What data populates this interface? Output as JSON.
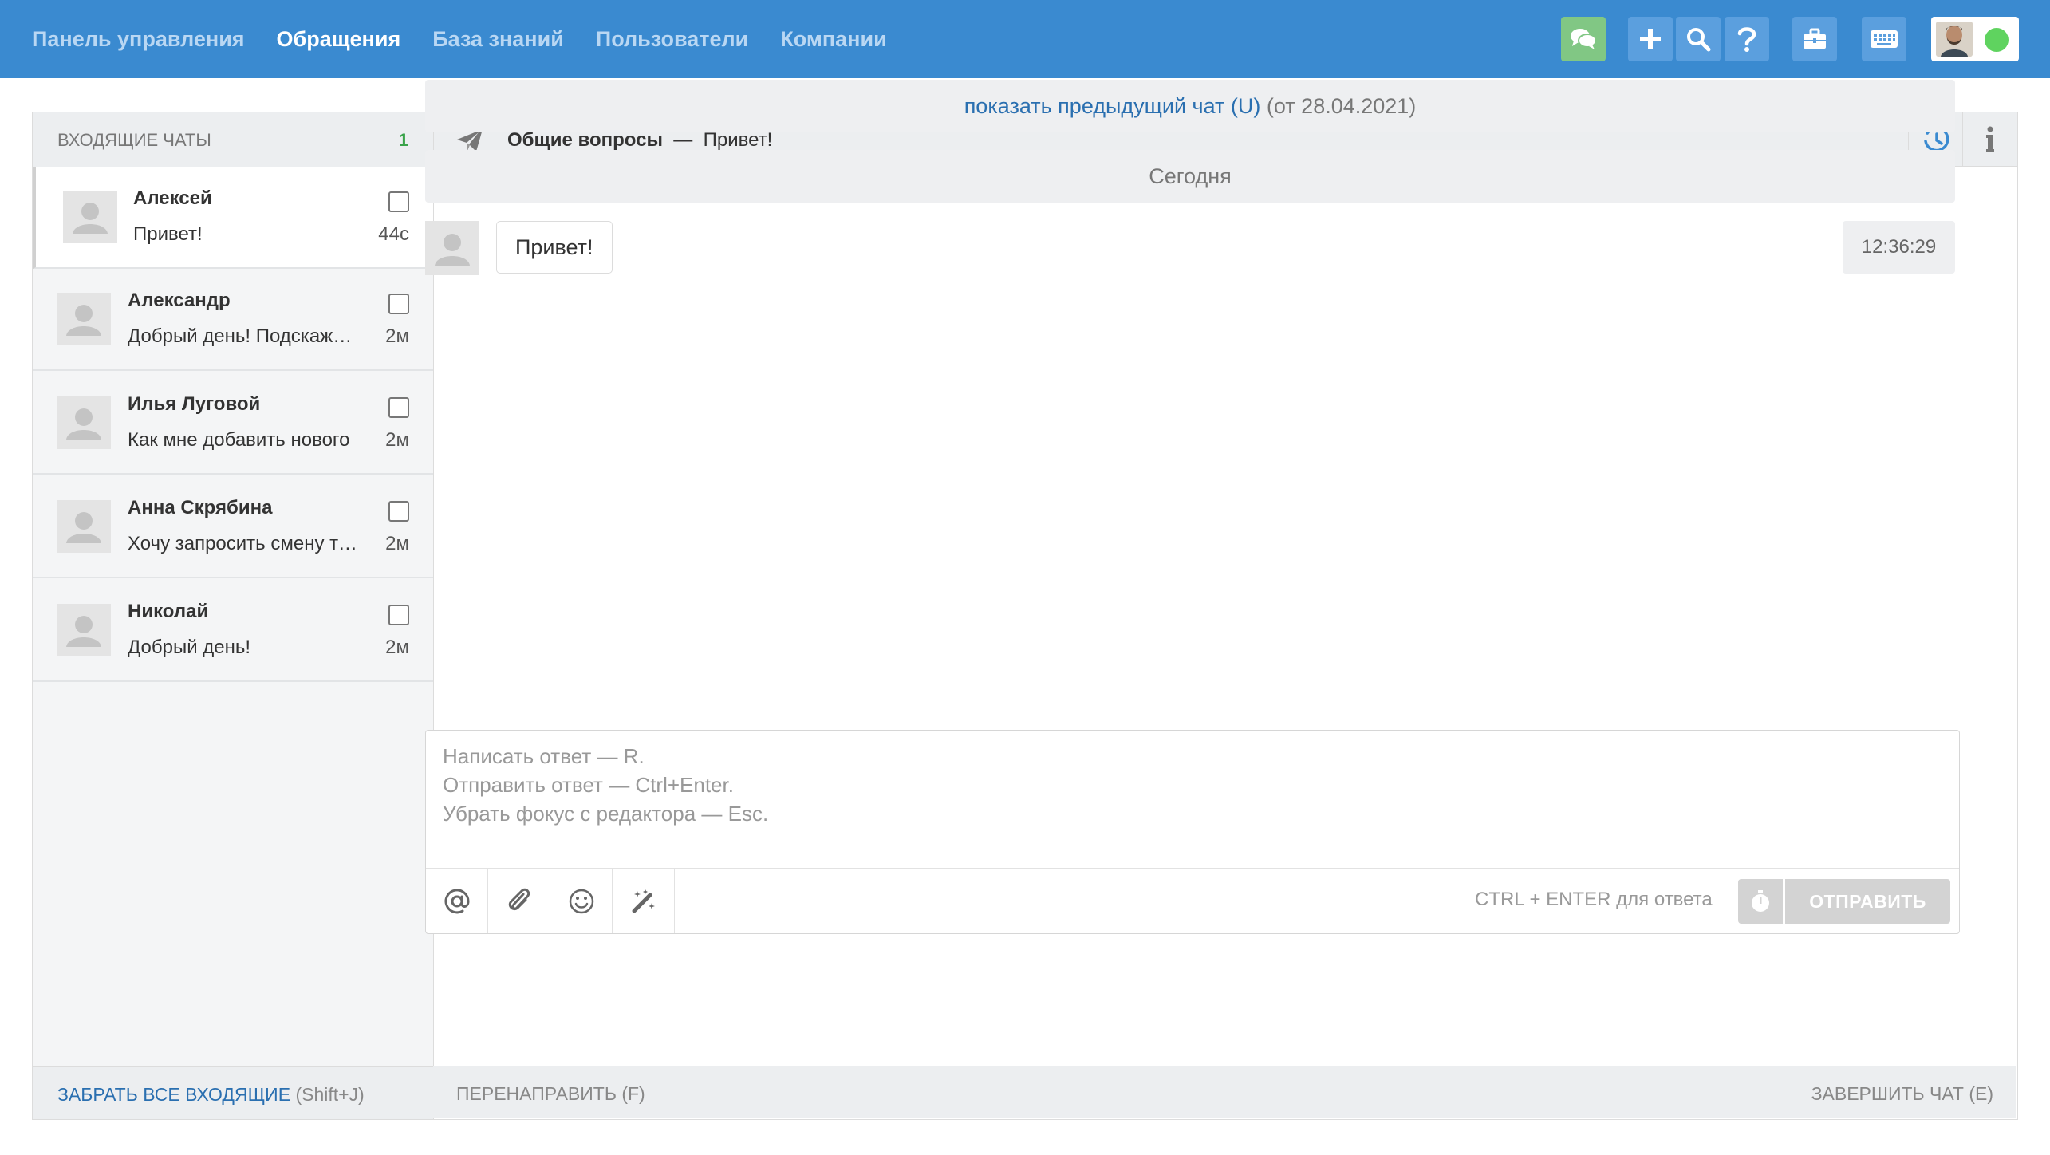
{
  "nav": {
    "items": [
      {
        "label": "Панель управления",
        "active": false
      },
      {
        "label": "Обращения",
        "active": true
      },
      {
        "label": "База знаний",
        "active": false
      },
      {
        "label": "Пользователи",
        "active": false
      },
      {
        "label": "Компании",
        "active": false
      }
    ],
    "right_icons": [
      "chat-bubbles-icon",
      "plus-icon",
      "search-icon",
      "question-icon",
      "briefcase-icon",
      "keyboard-icon"
    ],
    "user_status": "online"
  },
  "inbox": {
    "title": "ВХОДЯЩИЕ ЧАТЫ",
    "count": "1",
    "chats": [
      {
        "name": "Алексей",
        "preview": "Привет!",
        "time": "44с",
        "active": true
      },
      {
        "name": "Александр",
        "preview": "Добрый день! Подскажите",
        "time": "2м",
        "active": false
      },
      {
        "name": "Илья Луговой",
        "preview": "Как мне добавить нового",
        "time": "2м",
        "active": false
      },
      {
        "name": "Анна Скрябина",
        "preview": "Хочу запросить смену тарифа",
        "time": "2м",
        "active": false
      },
      {
        "name": "Николай",
        "preview": "Добрый день!",
        "time": "2м",
        "active": false
      }
    ],
    "footer_link": "ЗАБРАТЬ ВСЕ ВХОДЯЩИЕ",
    "footer_hint": "(Shift+J)"
  },
  "conversation": {
    "topic": "Общие вопросы",
    "separator": "—",
    "subject": "Привет!",
    "previous_link": "показать предыдущий чат (U)",
    "previous_date": "(от 28.04.2021)",
    "day_label": "Сегодня",
    "messages": [
      {
        "text": "Привет!",
        "time": "12:36:29"
      }
    ],
    "editor_placeholder": "Написать ответ — R.\nОтправить ответ — Ctrl+Enter.\nУбрать фокус с редактора — Esc.",
    "ctrl_hint": "CTRL + ENTER для ответа",
    "send_label": "ОТПРАВИТЬ",
    "forward_label": "ПЕРЕНАПРАВИТЬ (F)",
    "end_label": "ЗАВЕРШИТЬ ЧАТ (E)"
  },
  "colors": {
    "topbar": "#3a8ad0",
    "link": "#2a6fb0",
    "count": "#3aa34a",
    "chat_button": "#81c784",
    "status_online": "#5fd35f"
  }
}
